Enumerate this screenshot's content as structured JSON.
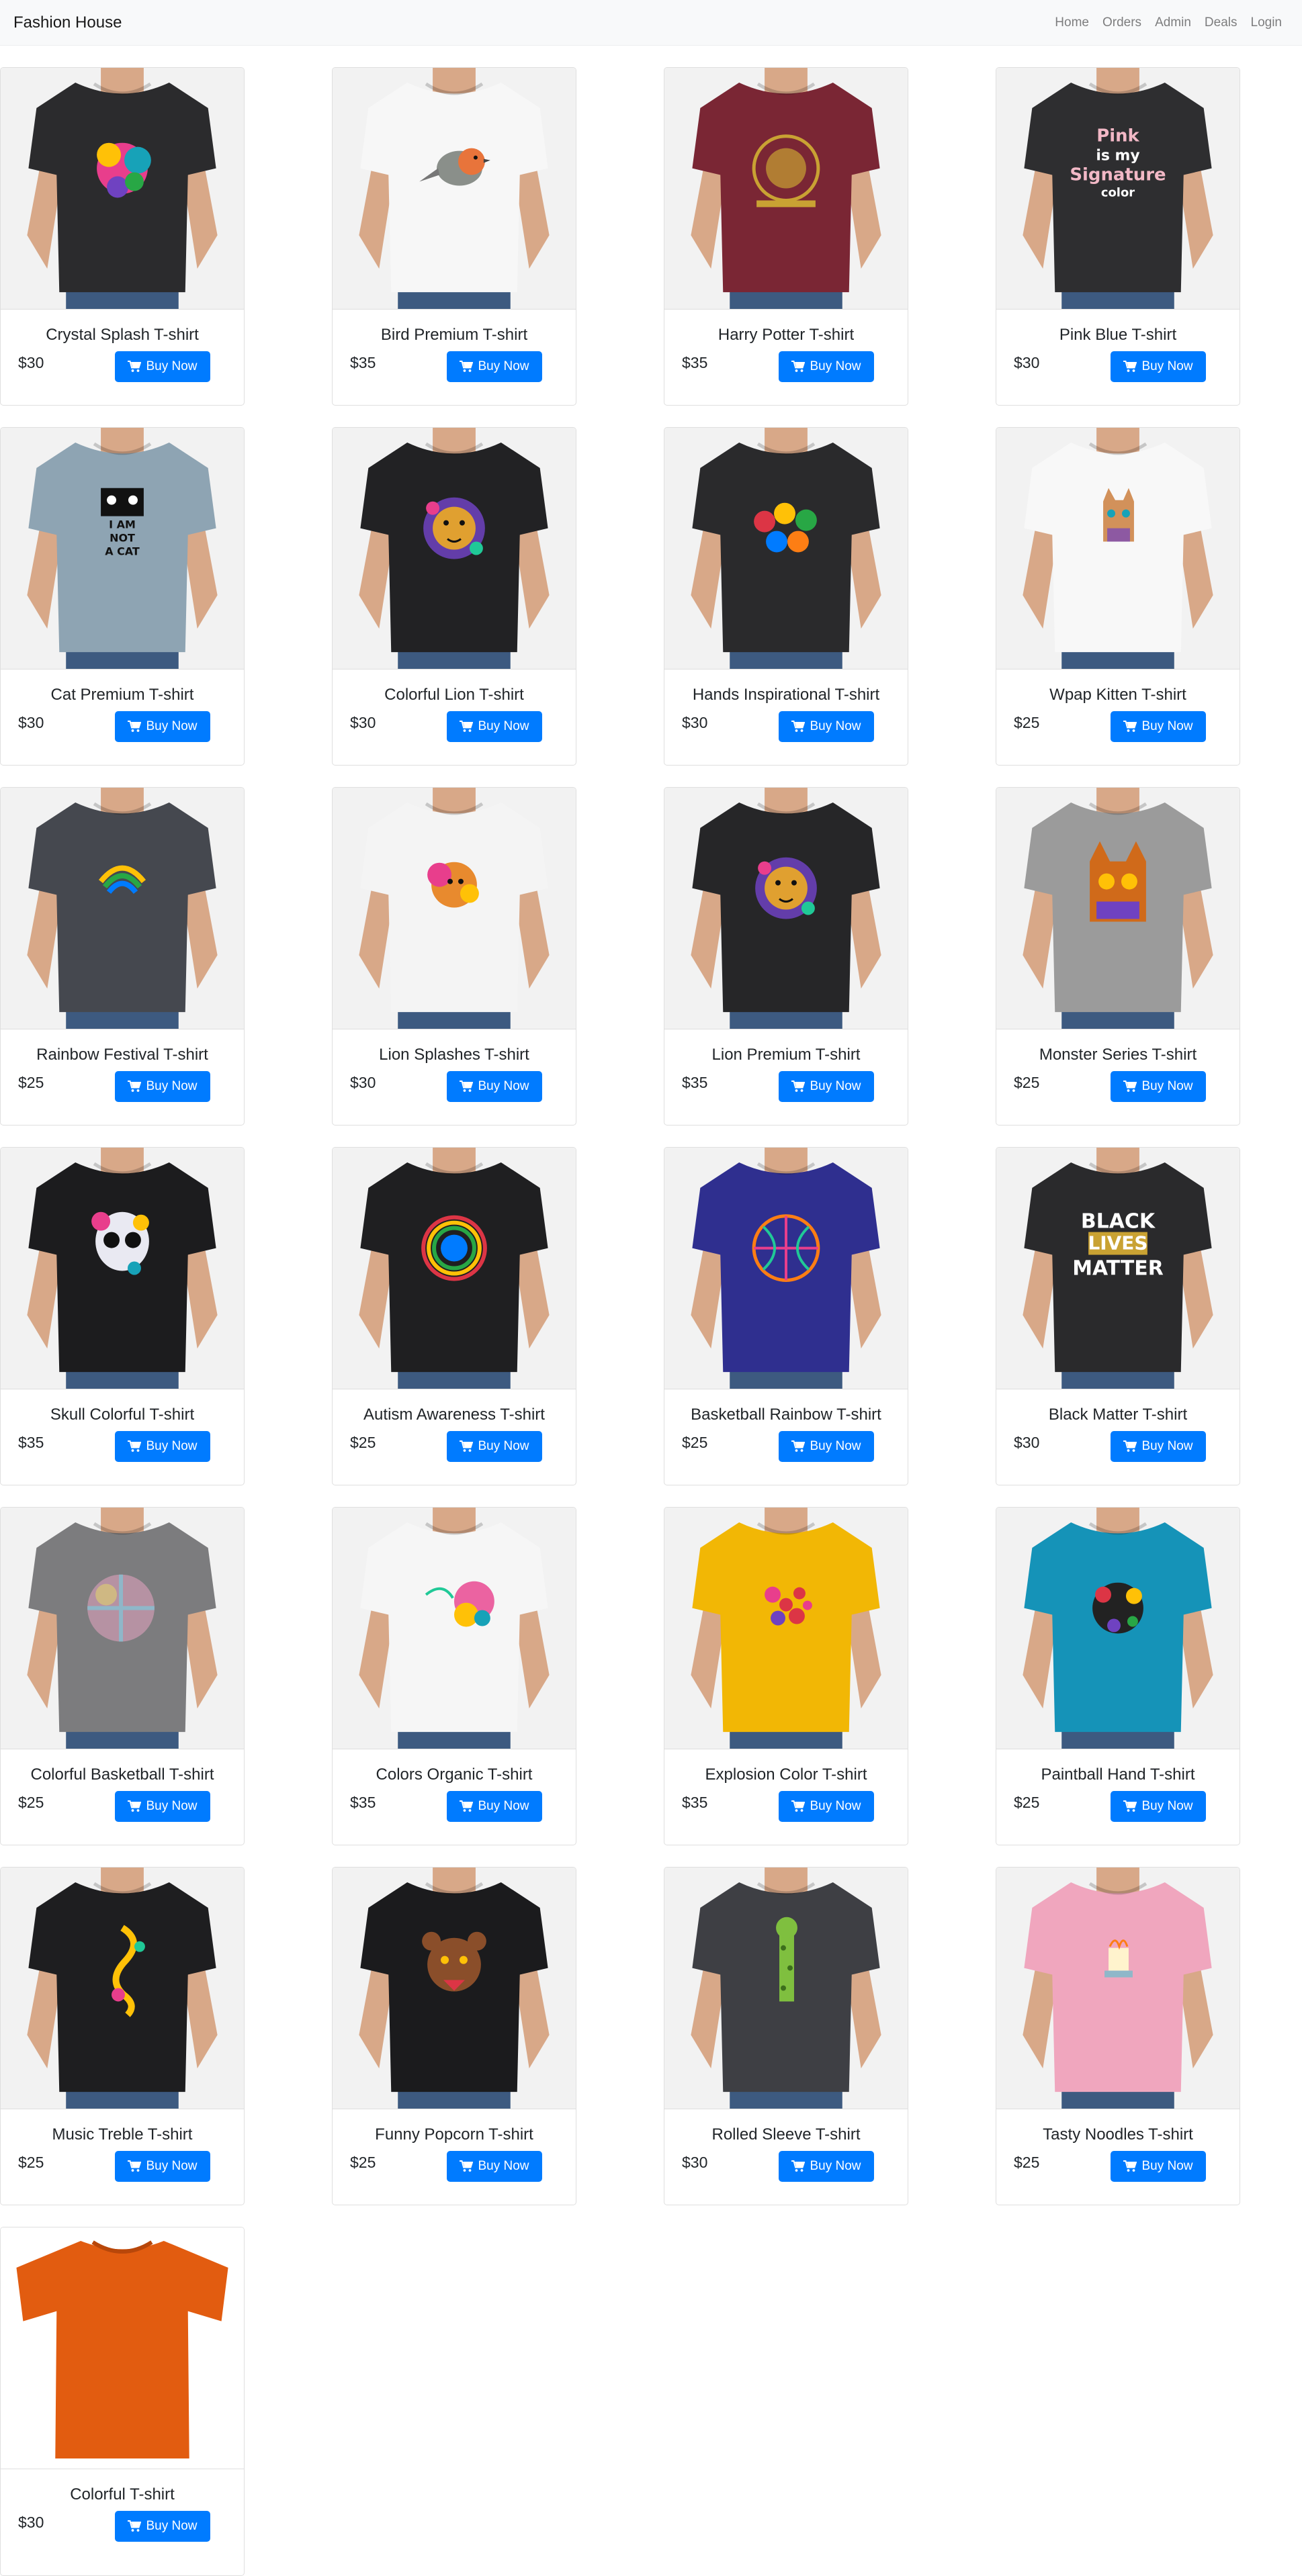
{
  "navbar": {
    "brand": "Fashion House",
    "links": [
      "Home",
      "Orders",
      "Admin",
      "Deals",
      "Login"
    ]
  },
  "buy_label": "Buy Now",
  "products": [
    {
      "name": "Crystal Splash T-shirt",
      "price": "$30",
      "shirt_color": "#2b2b2d",
      "print": "splash"
    },
    {
      "name": "Bird Premium T-shirt",
      "price": "$35",
      "shirt_color": "#f7f7f7",
      "print": "bird"
    },
    {
      "name": "Harry Potter T-shirt",
      "price": "$35",
      "shirt_color": "#7a2634",
      "print": "lion-gold"
    },
    {
      "name": "Pink Blue T-shirt",
      "price": "$30",
      "shirt_color": "#2e2e30",
      "print": "pink-text"
    },
    {
      "name": "Cat Premium T-shirt",
      "price": "$30",
      "shirt_color": "#8ea4b3",
      "print": "cat-text"
    },
    {
      "name": "Colorful Lion T-shirt",
      "price": "$30",
      "shirt_color": "#222224",
      "print": "lion-color"
    },
    {
      "name": "Hands Inspirational T-shirt",
      "price": "$30",
      "shirt_color": "#2a2a2c",
      "print": "hands"
    },
    {
      "name": "Wpap Kitten T-shirt",
      "price": "$25",
      "shirt_color": "#f8f8f8",
      "print": "kitten"
    },
    {
      "name": "Rainbow Festival T-shirt",
      "price": "$25",
      "shirt_color": "#45484f",
      "print": "rainbow"
    },
    {
      "name": "Lion Splashes T-shirt",
      "price": "$30",
      "shirt_color": "#f4f4f4",
      "print": "lion-splash"
    },
    {
      "name": "Lion Premium T-shirt",
      "price": "$35",
      "shirt_color": "#262628",
      "print": "lion-color"
    },
    {
      "name": "Monster Series T-shirt",
      "price": "$25",
      "shirt_color": "#9b9b9b",
      "print": "monster"
    },
    {
      "name": "Skull Colorful T-shirt",
      "price": "$35",
      "shirt_color": "#1c1c1e",
      "print": "skull"
    },
    {
      "name": "Autism Awareness T-shirt",
      "price": "$25",
      "shirt_color": "#1f1f21",
      "print": "circle-text"
    },
    {
      "name": "Basketball Rainbow T-shirt",
      "price": "$25",
      "shirt_color": "#2f2f8f",
      "print": "ball"
    },
    {
      "name": "Black Matter T-shirt",
      "price": "$30",
      "shirt_color": "#2a2a2c",
      "print": "blm"
    },
    {
      "name": "Colorful Basketball T-shirt",
      "price": "$25",
      "shirt_color": "#7c7c7e",
      "print": "ball-soft"
    },
    {
      "name": "Colors Organic T-shirt",
      "price": "$35",
      "shirt_color": "#f6f6f6",
      "print": "organic"
    },
    {
      "name": "Explosion Color T-shirt",
      "price": "$35",
      "shirt_color": "#f2b705",
      "print": "explosion"
    },
    {
      "name": "Paintball Hand T-shirt",
      "price": "$25",
      "shirt_color": "#1593b8",
      "print": "paintball"
    },
    {
      "name": "Music Treble T-shirt",
      "price": "$25",
      "shirt_color": "#1e1e20",
      "print": "treble"
    },
    {
      "name": "Funny Popcorn T-shirt",
      "price": "$25",
      "shirt_color": "#1b1b1d",
      "print": "bear"
    },
    {
      "name": "Rolled Sleeve T-shirt",
      "price": "$30",
      "shirt_color": "#3e3f44",
      "print": "giraffe"
    },
    {
      "name": "Tasty Noodles T-shirt",
      "price": "$25",
      "shirt_color": "#f0a6be",
      "print": "noodles"
    },
    {
      "name": "Colorful T-shirt",
      "price": "$30",
      "shirt_color": "#e25c10",
      "print": "none"
    }
  ],
  "print_text": {
    "pink-text": [
      "Pink",
      "is my",
      "Signature",
      "color"
    ],
    "cat-text": [
      "I AM",
      "NOT",
      "A CAT"
    ],
    "blm": [
      "BLACK",
      "LIVES",
      "MATTER"
    ]
  }
}
